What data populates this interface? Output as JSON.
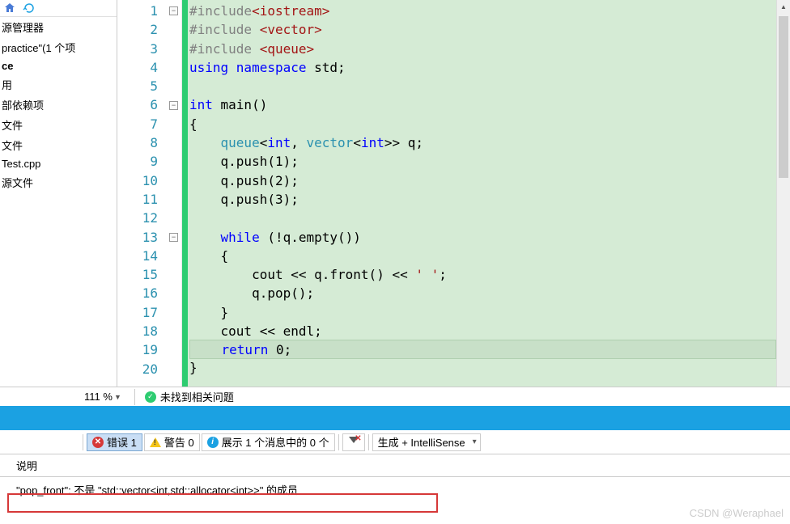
{
  "sidebar": {
    "manager_title": "源管理器",
    "project": "practice\"(1 个项",
    "items": [
      "ce",
      "用",
      "部依赖项",
      "文件",
      "文件",
      "Test.cpp",
      "源文件"
    ]
  },
  "code": {
    "lines": [
      {
        "n": 1,
        "fold": "-",
        "tokens": [
          {
            "t": "#include",
            "c": "pp"
          },
          {
            "t": "<iostream>",
            "c": "inc"
          }
        ]
      },
      {
        "n": 2,
        "tokens": [
          {
            "t": "#include ",
            "c": "pp"
          },
          {
            "t": "<vector>",
            "c": "inc"
          }
        ]
      },
      {
        "n": 3,
        "tokens": [
          {
            "t": "#include ",
            "c": "pp"
          },
          {
            "t": "<queue>",
            "c": "inc"
          }
        ]
      },
      {
        "n": 4,
        "tokens": [
          {
            "t": "using ",
            "c": "kw"
          },
          {
            "t": "namespace ",
            "c": "kw"
          },
          {
            "t": "std;",
            "c": "id"
          }
        ]
      },
      {
        "n": 5,
        "tokens": []
      },
      {
        "n": 6,
        "fold": "-",
        "tokens": [
          {
            "t": "int ",
            "c": "kw"
          },
          {
            "t": "main()",
            "c": "id"
          }
        ]
      },
      {
        "n": 7,
        "tokens": [
          {
            "t": "{",
            "c": "id"
          }
        ]
      },
      {
        "n": 8,
        "indent": 1,
        "tokens": [
          {
            "t": "queue",
            "c": "typ"
          },
          {
            "t": "<",
            "c": "id"
          },
          {
            "t": "int",
            "c": "kw"
          },
          {
            "t": ", ",
            "c": "id"
          },
          {
            "t": "vector",
            "c": "typ"
          },
          {
            "t": "<",
            "c": "id"
          },
          {
            "t": "int",
            "c": "kw"
          },
          {
            "t": ">> q;",
            "c": "id"
          }
        ]
      },
      {
        "n": 9,
        "indent": 1,
        "tokens": [
          {
            "t": "q.push(1);",
            "c": "id"
          }
        ]
      },
      {
        "n": 10,
        "indent": 1,
        "tokens": [
          {
            "t": "q.push(2);",
            "c": "id"
          }
        ]
      },
      {
        "n": 11,
        "indent": 1,
        "tokens": [
          {
            "t": "q.push(3);",
            "c": "id"
          }
        ]
      },
      {
        "n": 12,
        "tokens": []
      },
      {
        "n": 13,
        "indent": 1,
        "fold": "-",
        "tokens": [
          {
            "t": "while ",
            "c": "kw"
          },
          {
            "t": "(!q.empty())",
            "c": "id"
          }
        ]
      },
      {
        "n": 14,
        "indent": 1,
        "tokens": [
          {
            "t": "{",
            "c": "id"
          }
        ]
      },
      {
        "n": 15,
        "indent": 2,
        "tokens": [
          {
            "t": "cout << q.front() << ",
            "c": "id"
          },
          {
            "t": "' '",
            "c": "str"
          },
          {
            "t": ";",
            "c": "id"
          }
        ]
      },
      {
        "n": 16,
        "indent": 2,
        "tokens": [
          {
            "t": "q.pop();",
            "c": "id"
          }
        ]
      },
      {
        "n": 17,
        "indent": 1,
        "tokens": [
          {
            "t": "}",
            "c": "id"
          }
        ]
      },
      {
        "n": 18,
        "indent": 1,
        "tokens": [
          {
            "t": "cout << endl;",
            "c": "id"
          }
        ]
      },
      {
        "n": 19,
        "indent": 1,
        "hl": true,
        "tokens": [
          {
            "t": "return ",
            "c": "kw"
          },
          {
            "t": "0;",
            "c": "id"
          }
        ]
      },
      {
        "n": 20,
        "tokens": [
          {
            "t": "}",
            "c": "id"
          }
        ]
      }
    ]
  },
  "status": {
    "zoom": "111 %",
    "ok_text": "未找到相关问题"
  },
  "error_toolbar": {
    "errors": "错误 1",
    "warnings": "警告 0",
    "info": "展示 1 个消息中的 0 个",
    "build_dropdown": "生成 + IntelliSense"
  },
  "grid": {
    "header": "说明",
    "row1": "\"pop_front\": 不是 \"std::vector<int,std::allocator<int>>\" 的成员"
  },
  "watermark": "CSDN @Weraphael"
}
